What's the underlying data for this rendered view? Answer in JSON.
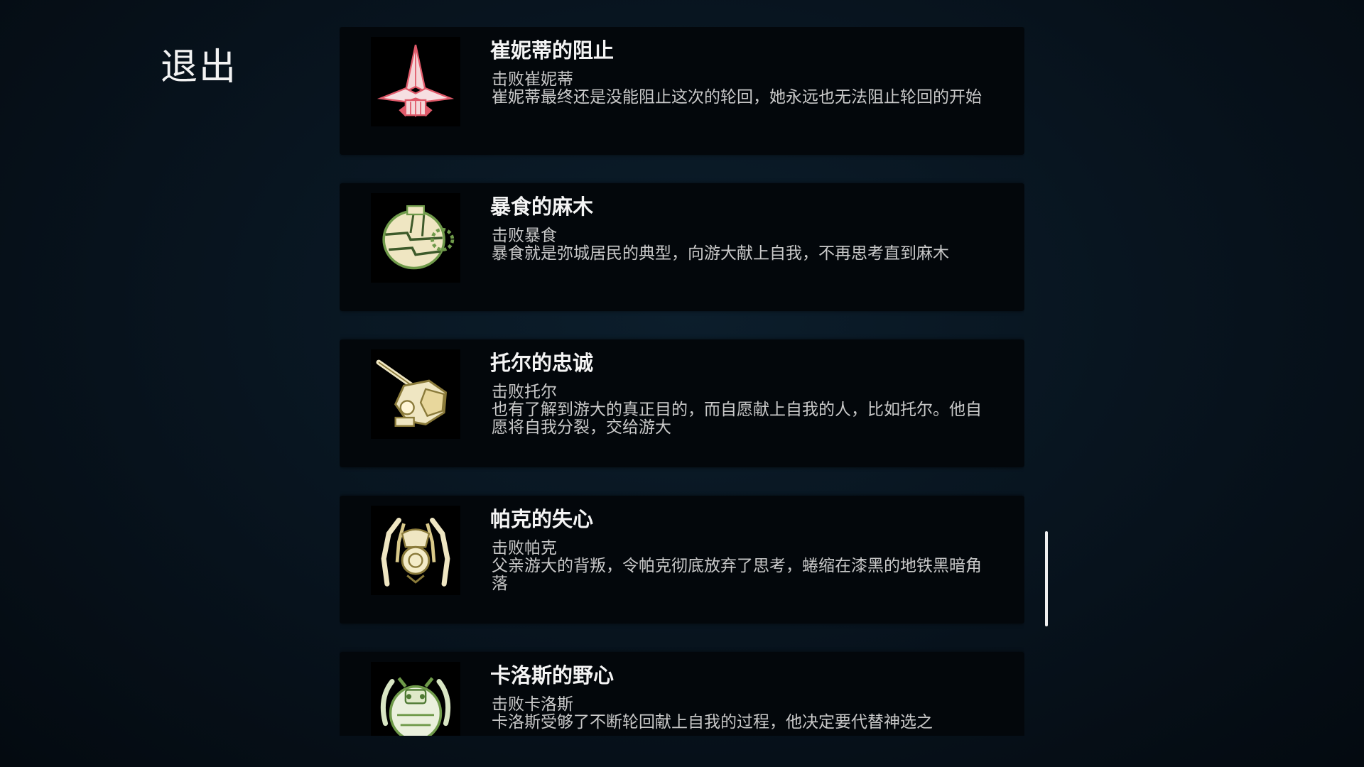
{
  "exit_label": "退出",
  "achievements": [
    {
      "title": "崔妮蒂的阻止",
      "condition": "击败崔妮蒂",
      "description": "崔妮蒂最终还是没能阻止这次的轮回，她永远也无法阻止轮回的开始",
      "icon": "red-ship-icon"
    },
    {
      "title": "暴食的麻木",
      "condition": "击败暴食",
      "description": "暴食就是弥城居民的典型，向游大献上自我，不再思考直到麻木",
      "icon": "armored-sphere-icon"
    },
    {
      "title": "托尔的忠诚",
      "condition": "击败托尔",
      "description": "也有了解到游大的真正目的，而自愿献上自我的人，比如托尔。他自愿将自我分裂，交给游大",
      "icon": "cannon-mech-icon"
    },
    {
      "title": "帕克的失心",
      "condition": "击败帕克",
      "description": "父亲游大的背叛，令帕克彻底放弃了思考，蜷缩在漆黑的地铁黑暗角落",
      "icon": "spider-mech-icon"
    },
    {
      "title": "卡洛斯的野心",
      "condition": "击败卡洛斯",
      "description": "卡洛斯受够了不断轮回献上自我的过程，他决定要代替神选之",
      "icon": "crab-mech-icon"
    }
  ],
  "colors": {
    "background": "#07121c",
    "card": "#03070b",
    "icon_red": "#e05a6a",
    "icon_cream": "#efe6c2"
  }
}
